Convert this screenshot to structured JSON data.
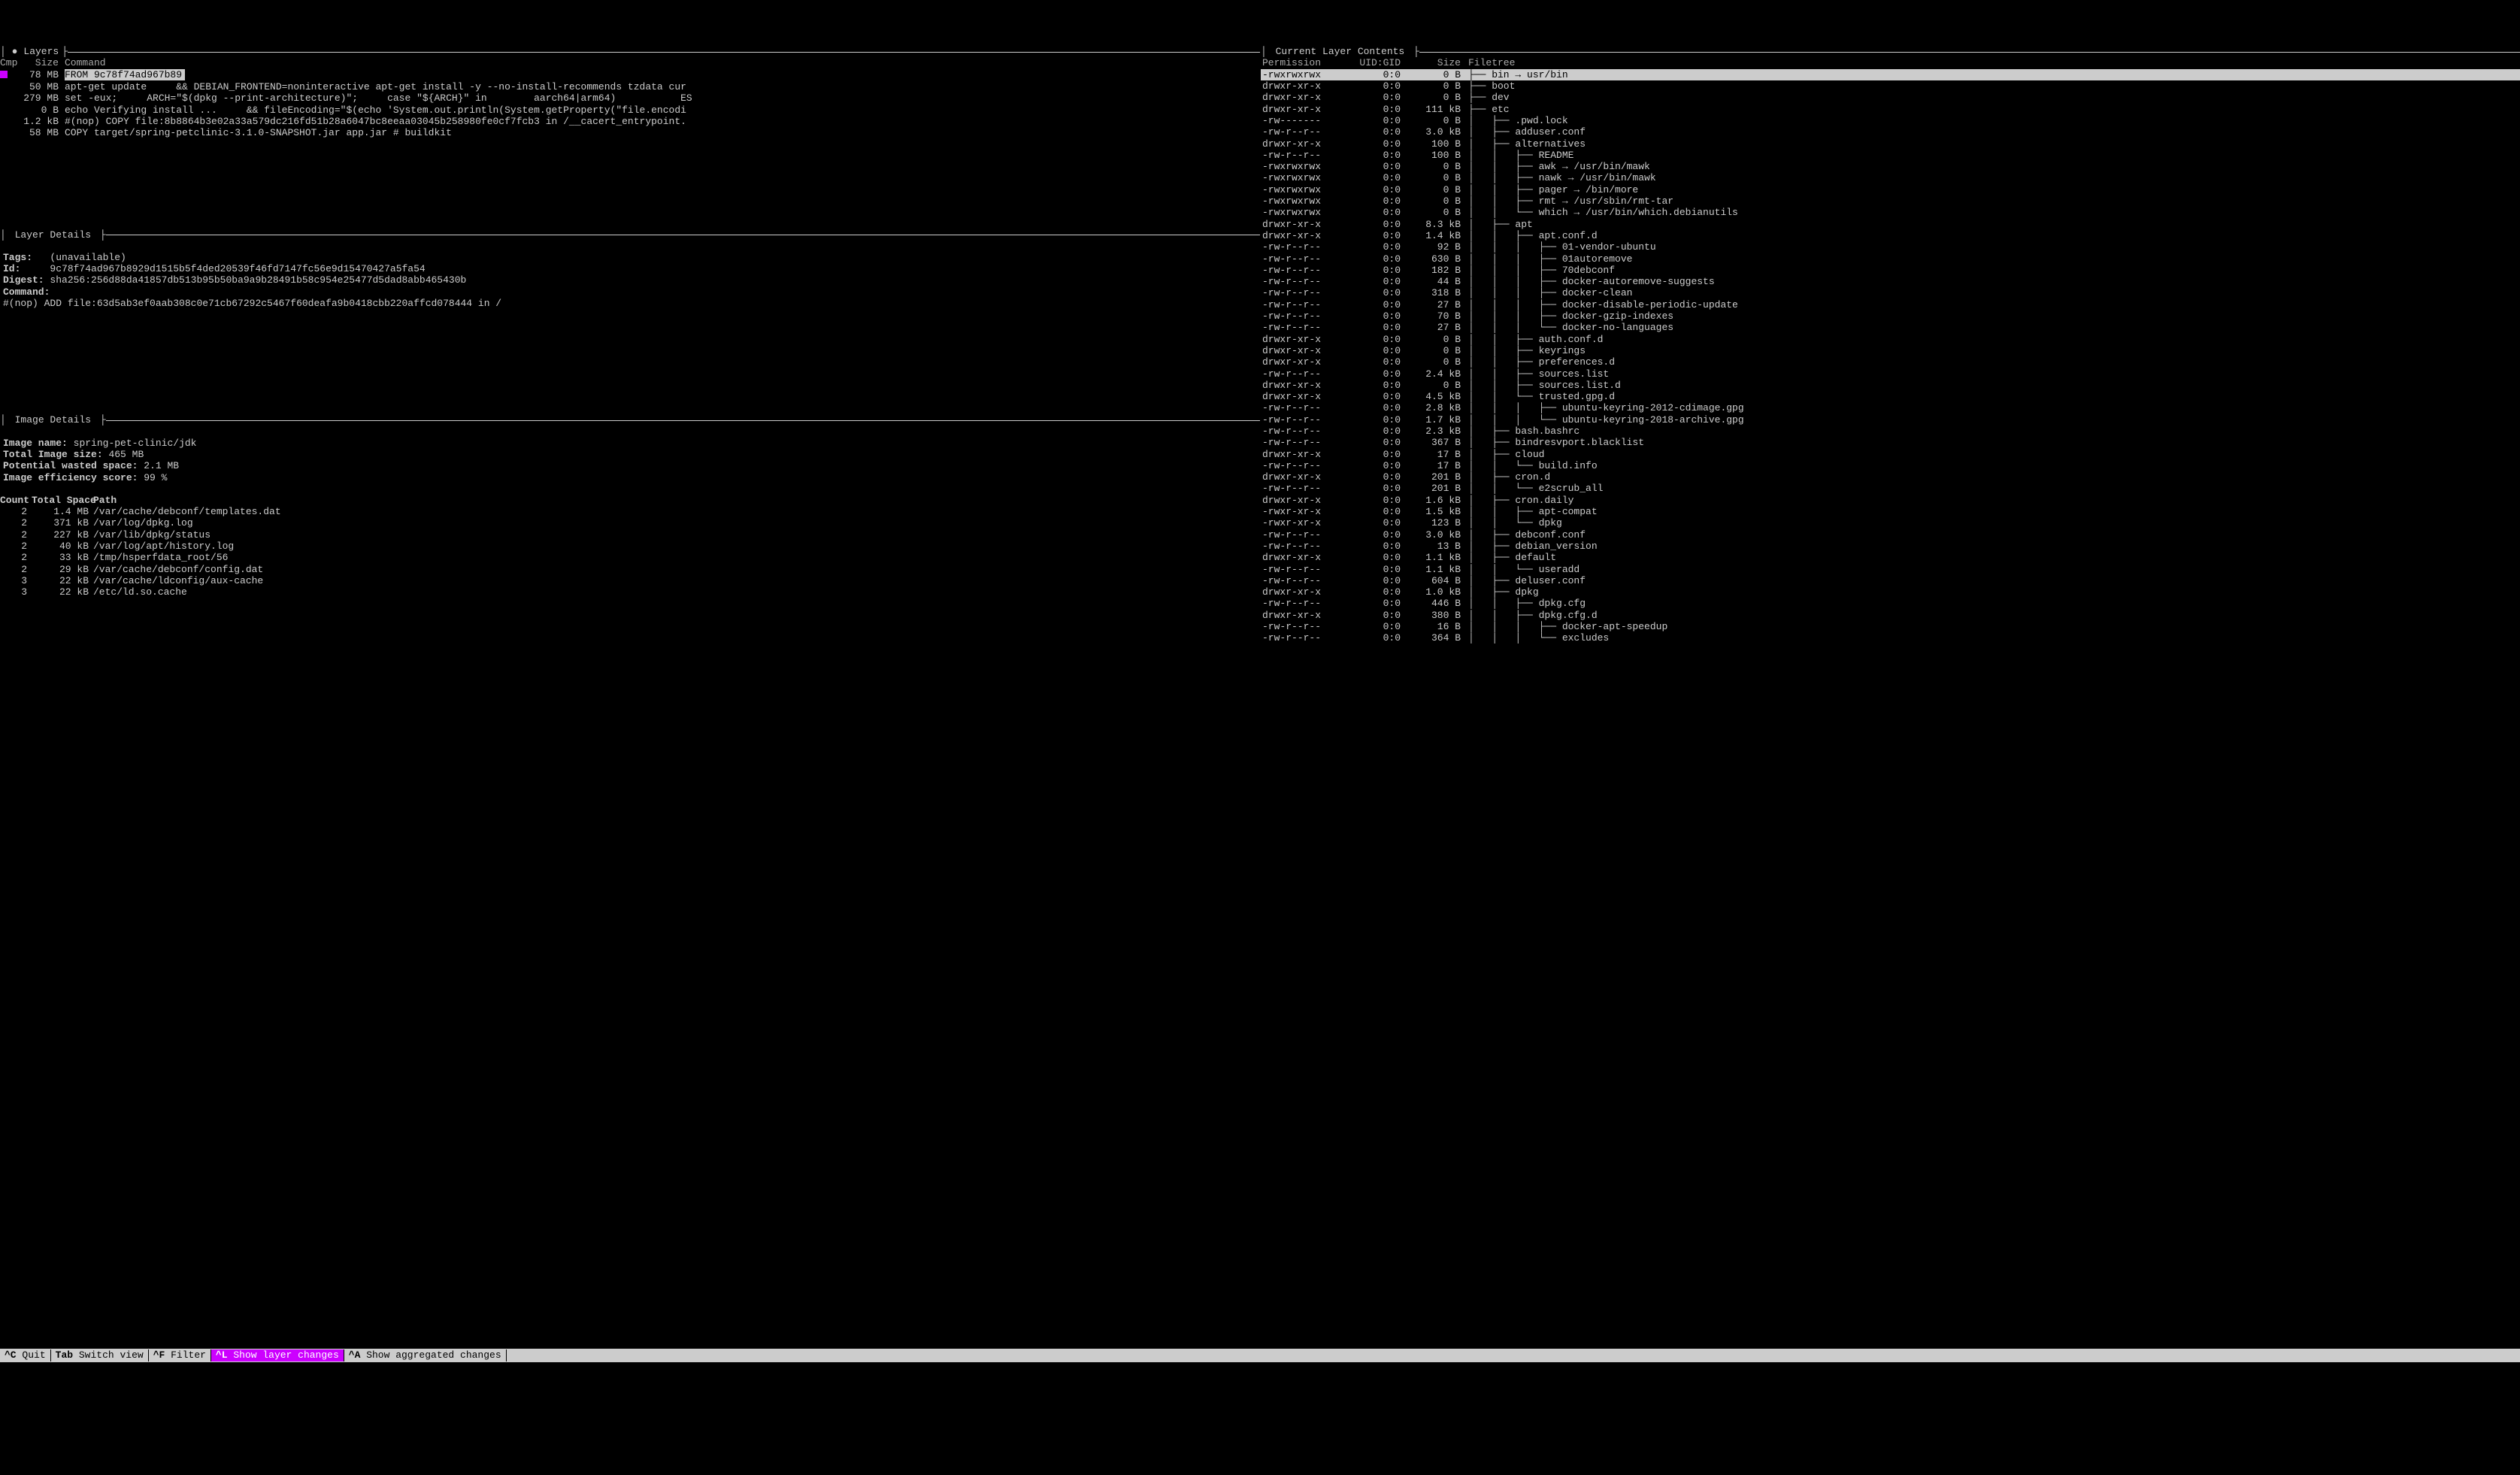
{
  "layers": {
    "title": "Layers",
    "header": {
      "cmp": "Cmp",
      "size": "Size",
      "command": "Command"
    },
    "rows": [
      {
        "cmp": "",
        "size": "78 MB",
        "command": "FROM 9c78f74ad967b89",
        "selected": true
      },
      {
        "cmp": "",
        "size": "50 MB",
        "command": "apt-get update     && DEBIAN_FRONTEND=noninteractive apt-get install -y --no-install-recommends tzdata cur"
      },
      {
        "cmp": "",
        "size": "279 MB",
        "command": "set -eux;     ARCH=\"$(dpkg --print-architecture)\";     case \"${ARCH}\" in        aarch64|arm64)           ES"
      },
      {
        "cmp": "",
        "size": "0 B",
        "command": "echo Verifying install ...     && fileEncoding=\"$(echo 'System.out.println(System.getProperty(\"file.encodi"
      },
      {
        "cmp": "",
        "size": "1.2 kB",
        "command": "#(nop) COPY file:8b8864b3e02a33a579dc216fd51b28a6047bc8eeaa03045b258980fe0cf7fcb3 in /__cacert_entrypoint."
      },
      {
        "cmp": "",
        "size": "58 MB",
        "command": "COPY target/spring-petclinic-3.1.0-SNAPSHOT.jar app.jar # buildkit"
      }
    ]
  },
  "layerDetails": {
    "title": "Layer Details",
    "tags_label": "Tags:",
    "tags_value": "(unavailable)",
    "id_label": "Id:",
    "id_value": "9c78f74ad967b8929d1515b5f4ded20539f46fd7147fc56e9d15470427a5fa54",
    "digest_label": "Digest:",
    "digest_value": "sha256:256d88da41857db513b95b50ba9a9b28491b58c954e25477d5dad8abb465430b",
    "command_label": "Command:",
    "command_value": "#(nop) ADD file:63d5ab3ef0aab308c0e71cb67292c5467f60deafa9b0418cbb220affcd078444 in /"
  },
  "imageDetails": {
    "title": "Image Details",
    "name_label": "Image name:",
    "name_value": "spring-pet-clinic/jdk",
    "total_label": "Total Image size:",
    "total_value": "465 MB",
    "wasted_label": "Potential wasted space:",
    "wasted_value": "2.1 MB",
    "eff_label": "Image efficiency score:",
    "eff_value": "99 %",
    "waste_header": {
      "count": "Count",
      "total": "Total Space",
      "path": "Path"
    },
    "waste_rows": [
      {
        "count": "2",
        "total": "1.4 MB",
        "path": "/var/cache/debconf/templates.dat"
      },
      {
        "count": "2",
        "total": "371 kB",
        "path": "/var/log/dpkg.log"
      },
      {
        "count": "2",
        "total": "227 kB",
        "path": "/var/lib/dpkg/status"
      },
      {
        "count": "2",
        "total": "40 kB",
        "path": "/var/log/apt/history.log"
      },
      {
        "count": "2",
        "total": "33 kB",
        "path": "/tmp/hsperfdata_root/56"
      },
      {
        "count": "2",
        "total": "29 kB",
        "path": "/var/cache/debconf/config.dat"
      },
      {
        "count": "3",
        "total": "22 kB",
        "path": "/var/cache/ldconfig/aux-cache"
      },
      {
        "count": "3",
        "total": "22 kB",
        "path": "/etc/ld.so.cache"
      }
    ]
  },
  "contents": {
    "title": "Current Layer Contents",
    "header": {
      "perm": "Permission",
      "uid": "UID:GID",
      "size": "Size",
      "tree": "Filetree"
    },
    "rows": [
      {
        "perm": "-rwxrwxrwx",
        "uid": "0:0",
        "size": "0 B",
        "depth": 0,
        "name": "bin → usr/bin",
        "last": false,
        "sel": true
      },
      {
        "perm": "drwxr-xr-x",
        "uid": "0:0",
        "size": "0 B",
        "depth": 0,
        "name": "boot",
        "last": false
      },
      {
        "perm": "drwxr-xr-x",
        "uid": "0:0",
        "size": "0 B",
        "depth": 0,
        "name": "dev",
        "last": false
      },
      {
        "perm": "drwxr-xr-x",
        "uid": "0:0",
        "size": "111 kB",
        "depth": 0,
        "name": "etc",
        "last": false
      },
      {
        "perm": "-rw-------",
        "uid": "0:0",
        "size": "0 B",
        "depth": 1,
        "name": ".pwd.lock",
        "last": false
      },
      {
        "perm": "-rw-r--r--",
        "uid": "0:0",
        "size": "3.0 kB",
        "depth": 1,
        "name": "adduser.conf",
        "last": false
      },
      {
        "perm": "drwxr-xr-x",
        "uid": "0:0",
        "size": "100 B",
        "depth": 1,
        "name": "alternatives",
        "last": false
      },
      {
        "perm": "-rw-r--r--",
        "uid": "0:0",
        "size": "100 B",
        "depth": 2,
        "name": "README",
        "last": false
      },
      {
        "perm": "-rwxrwxrwx",
        "uid": "0:0",
        "size": "0 B",
        "depth": 2,
        "name": "awk → /usr/bin/mawk",
        "last": false
      },
      {
        "perm": "-rwxrwxrwx",
        "uid": "0:0",
        "size": "0 B",
        "depth": 2,
        "name": "nawk → /usr/bin/mawk",
        "last": false
      },
      {
        "perm": "-rwxrwxrwx",
        "uid": "0:0",
        "size": "0 B",
        "depth": 2,
        "name": "pager → /bin/more",
        "last": false
      },
      {
        "perm": "-rwxrwxrwx",
        "uid": "0:0",
        "size": "0 B",
        "depth": 2,
        "name": "rmt → /usr/sbin/rmt-tar",
        "last": false
      },
      {
        "perm": "-rwxrwxrwx",
        "uid": "0:0",
        "size": "0 B",
        "depth": 2,
        "name": "which → /usr/bin/which.debianutils",
        "last": true
      },
      {
        "perm": "drwxr-xr-x",
        "uid": "0:0",
        "size": "8.3 kB",
        "depth": 1,
        "name": "apt",
        "last": false
      },
      {
        "perm": "drwxr-xr-x",
        "uid": "0:0",
        "size": "1.4 kB",
        "depth": 2,
        "name": "apt.conf.d",
        "last": false
      },
      {
        "perm": "-rw-r--r--",
        "uid": "0:0",
        "size": "92 B",
        "depth": 3,
        "name": "01-vendor-ubuntu",
        "last": false
      },
      {
        "perm": "-rw-r--r--",
        "uid": "0:0",
        "size": "630 B",
        "depth": 3,
        "name": "01autoremove",
        "last": false
      },
      {
        "perm": "-rw-r--r--",
        "uid": "0:0",
        "size": "182 B",
        "depth": 3,
        "name": "70debconf",
        "last": false
      },
      {
        "perm": "-rw-r--r--",
        "uid": "0:0",
        "size": "44 B",
        "depth": 3,
        "name": "docker-autoremove-suggests",
        "last": false
      },
      {
        "perm": "-rw-r--r--",
        "uid": "0:0",
        "size": "318 B",
        "depth": 3,
        "name": "docker-clean",
        "last": false
      },
      {
        "perm": "-rw-r--r--",
        "uid": "0:0",
        "size": "27 B",
        "depth": 3,
        "name": "docker-disable-periodic-update",
        "last": false
      },
      {
        "perm": "-rw-r--r--",
        "uid": "0:0",
        "size": "70 B",
        "depth": 3,
        "name": "docker-gzip-indexes",
        "last": false
      },
      {
        "perm": "-rw-r--r--",
        "uid": "0:0",
        "size": "27 B",
        "depth": 3,
        "name": "docker-no-languages",
        "last": true
      },
      {
        "perm": "drwxr-xr-x",
        "uid": "0:0",
        "size": "0 B",
        "depth": 2,
        "name": "auth.conf.d",
        "last": false
      },
      {
        "perm": "drwxr-xr-x",
        "uid": "0:0",
        "size": "0 B",
        "depth": 2,
        "name": "keyrings",
        "last": false
      },
      {
        "perm": "drwxr-xr-x",
        "uid": "0:0",
        "size": "0 B",
        "depth": 2,
        "name": "preferences.d",
        "last": false
      },
      {
        "perm": "-rw-r--r--",
        "uid": "0:0",
        "size": "2.4 kB",
        "depth": 2,
        "name": "sources.list",
        "last": false
      },
      {
        "perm": "drwxr-xr-x",
        "uid": "0:0",
        "size": "0 B",
        "depth": 2,
        "name": "sources.list.d",
        "last": false
      },
      {
        "perm": "drwxr-xr-x",
        "uid": "0:0",
        "size": "4.5 kB",
        "depth": 2,
        "name": "trusted.gpg.d",
        "last": true
      },
      {
        "perm": "-rw-r--r--",
        "uid": "0:0",
        "size": "2.8 kB",
        "depth": 3,
        "name": "ubuntu-keyring-2012-cdimage.gpg",
        "last": false
      },
      {
        "perm": "-rw-r--r--",
        "uid": "0:0",
        "size": "1.7 kB",
        "depth": 3,
        "name": "ubuntu-keyring-2018-archive.gpg",
        "last": true
      },
      {
        "perm": "-rw-r--r--",
        "uid": "0:0",
        "size": "2.3 kB",
        "depth": 1,
        "name": "bash.bashrc",
        "last": false
      },
      {
        "perm": "-rw-r--r--",
        "uid": "0:0",
        "size": "367 B",
        "depth": 1,
        "name": "bindresvport.blacklist",
        "last": false
      },
      {
        "perm": "drwxr-xr-x",
        "uid": "0:0",
        "size": "17 B",
        "depth": 1,
        "name": "cloud",
        "last": false
      },
      {
        "perm": "-rw-r--r--",
        "uid": "0:0",
        "size": "17 B",
        "depth": 2,
        "name": "build.info",
        "last": true
      },
      {
        "perm": "drwxr-xr-x",
        "uid": "0:0",
        "size": "201 B",
        "depth": 1,
        "name": "cron.d",
        "last": false
      },
      {
        "perm": "-rw-r--r--",
        "uid": "0:0",
        "size": "201 B",
        "depth": 2,
        "name": "e2scrub_all",
        "last": true
      },
      {
        "perm": "drwxr-xr-x",
        "uid": "0:0",
        "size": "1.6 kB",
        "depth": 1,
        "name": "cron.daily",
        "last": false
      },
      {
        "perm": "-rwxr-xr-x",
        "uid": "0:0",
        "size": "1.5 kB",
        "depth": 2,
        "name": "apt-compat",
        "last": false
      },
      {
        "perm": "-rwxr-xr-x",
        "uid": "0:0",
        "size": "123 B",
        "depth": 2,
        "name": "dpkg",
        "last": true
      },
      {
        "perm": "-rw-r--r--",
        "uid": "0:0",
        "size": "3.0 kB",
        "depth": 1,
        "name": "debconf.conf",
        "last": false
      },
      {
        "perm": "-rw-r--r--",
        "uid": "0:0",
        "size": "13 B",
        "depth": 1,
        "name": "debian_version",
        "last": false
      },
      {
        "perm": "drwxr-xr-x",
        "uid": "0:0",
        "size": "1.1 kB",
        "depth": 1,
        "name": "default",
        "last": false
      },
      {
        "perm": "-rw-r--r--",
        "uid": "0:0",
        "size": "1.1 kB",
        "depth": 2,
        "name": "useradd",
        "last": true
      },
      {
        "perm": "-rw-r--r--",
        "uid": "0:0",
        "size": "604 B",
        "depth": 1,
        "name": "deluser.conf",
        "last": false
      },
      {
        "perm": "drwxr-xr-x",
        "uid": "0:0",
        "size": "1.0 kB",
        "depth": 1,
        "name": "dpkg",
        "last": false
      },
      {
        "perm": "-rw-r--r--",
        "uid": "0:0",
        "size": "446 B",
        "depth": 2,
        "name": "dpkg.cfg",
        "last": false
      },
      {
        "perm": "drwxr-xr-x",
        "uid": "0:0",
        "size": "380 B",
        "depth": 2,
        "name": "dpkg.cfg.d",
        "last": false
      },
      {
        "perm": "-rw-r--r--",
        "uid": "0:0",
        "size": "16 B",
        "depth": 3,
        "name": "docker-apt-speedup",
        "last": false
      },
      {
        "perm": "-rw-r--r--",
        "uid": "0:0",
        "size": "364 B",
        "depth": 3,
        "name": "excludes",
        "last": true
      }
    ]
  },
  "footer": {
    "quit_k": "^C",
    "quit": "Quit",
    "tab_k": "Tab",
    "tab": "Switch view",
    "filter_k": "^F",
    "filter": "Filter",
    "layer_k": "^L",
    "layer": "Show layer changes",
    "agg_k": "^A",
    "agg": "Show aggregated changes"
  }
}
